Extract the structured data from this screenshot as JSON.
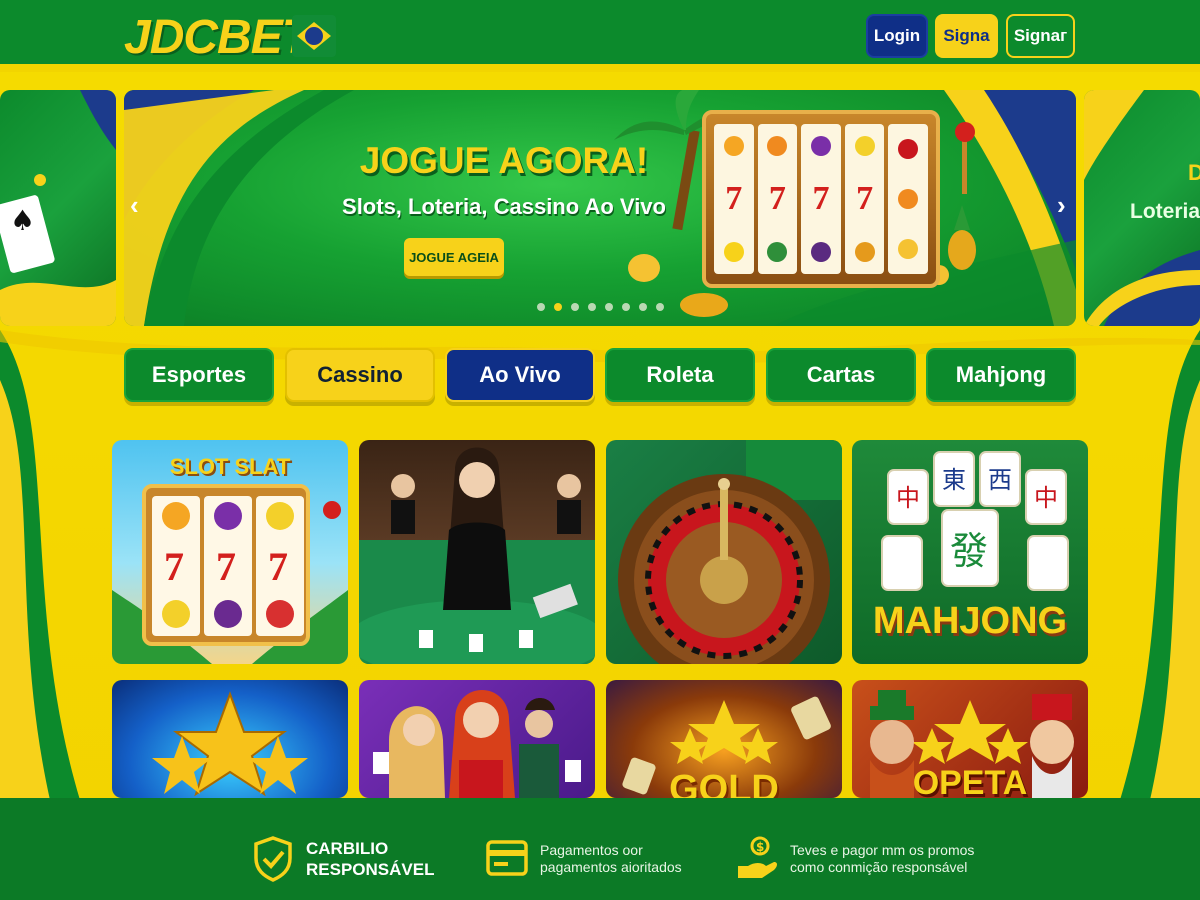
{
  "header": {
    "logo": "JDCBET",
    "buttons": {
      "login": "Login",
      "signa": "Signa",
      "signar": "Signaг"
    }
  },
  "carousel": {
    "title": "JOGUE AGORA!",
    "subtitle": "Slots, Loteria, Cassino Ao Vivo",
    "cta": "JOGUE AGEIA",
    "right_preview_title": "D",
    "right_preview_sub": "Loteria",
    "dots": 8,
    "active_dot": 1
  },
  "tabs": [
    {
      "label": "Esportes",
      "style": "green"
    },
    {
      "label": "Cassino",
      "style": "yellow"
    },
    {
      "label": "Ao Vivo",
      "style": "blue"
    },
    {
      "label": "Roleta",
      "style": "green"
    },
    {
      "label": "Cartas",
      "style": "green"
    },
    {
      "label": "Mahjong",
      "style": "green"
    }
  ],
  "games": [
    {
      "name": "SLOT SLAT"
    },
    {
      "name": ""
    },
    {
      "name": ""
    },
    {
      "name": "MAHJONG"
    },
    {
      "name": ""
    },
    {
      "name": ""
    },
    {
      "name": "GOLD"
    },
    {
      "name": "OPETA"
    }
  ],
  "footer": {
    "responsible_title": "CARBILIO RESPONSÁVEL",
    "responsible_line1": "CARBILIO",
    "responsible_line2": "RESPONSÁVEL",
    "payments_line1": "Pagamentos oor",
    "payments_line2": "pagamentos aioritados",
    "promos_line1": "Teves e pagor mm os promos",
    "promos_line2": "como conmição responsável"
  },
  "colors": {
    "green": "#0c8a2c",
    "yellow": "#f7d21a",
    "blue": "#0f2f87"
  },
  "icons": [
    "shield-check-icon",
    "credit-card-icon",
    "hand-coin-icon",
    "chevron-left-icon",
    "chevron-right-icon"
  ]
}
